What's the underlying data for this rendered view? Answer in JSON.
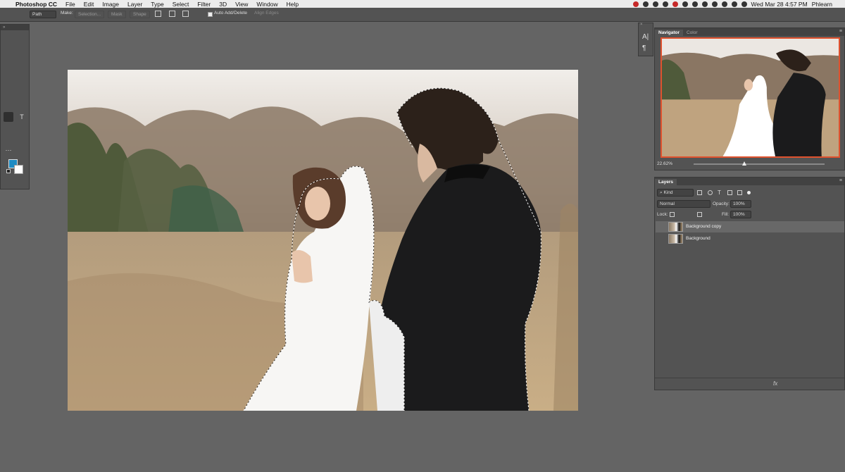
{
  "menubar": {
    "app_name": "Photoshop CC",
    "items": [
      "File",
      "Edit",
      "Image",
      "Layer",
      "Type",
      "Select",
      "Filter",
      "3D",
      "View",
      "Window",
      "Help"
    ],
    "clock": "Wed Mar 28  4:57 PM",
    "user": "Phlearn"
  },
  "options_bar": {
    "tool_mode": "Path",
    "make_label": "Make:",
    "selection_button": "Selection...",
    "mask_button": "Mask",
    "shape_button": "Shape",
    "auto_add_delete_label": "Auto Add/Delete",
    "auto_add_delete_checked": true,
    "align_edges_label": "Align Edges"
  },
  "toolbox": {
    "foreground_color": "#1e8bc3",
    "background_color": "#ffffff",
    "active_tool": "pen-tool-icon"
  },
  "navigator": {
    "tabs": [
      "Navigator",
      "Color"
    ],
    "active_tab": "Navigator",
    "zoom": "22.62%",
    "view_box_color": "#e0522e"
  },
  "layers": {
    "title": "Layers",
    "filter_kind": "Kind",
    "blend_mode": "Normal",
    "opacity_label": "Opacity:",
    "opacity": "100%",
    "lock_label": "Lock:",
    "fill_label": "Fill:",
    "fill": "100%",
    "items": [
      {
        "name": "Background copy",
        "visible": true,
        "selected": true,
        "locked": false
      },
      {
        "name": "Background",
        "visible": true,
        "selected": false,
        "locked": true
      }
    ]
  }
}
